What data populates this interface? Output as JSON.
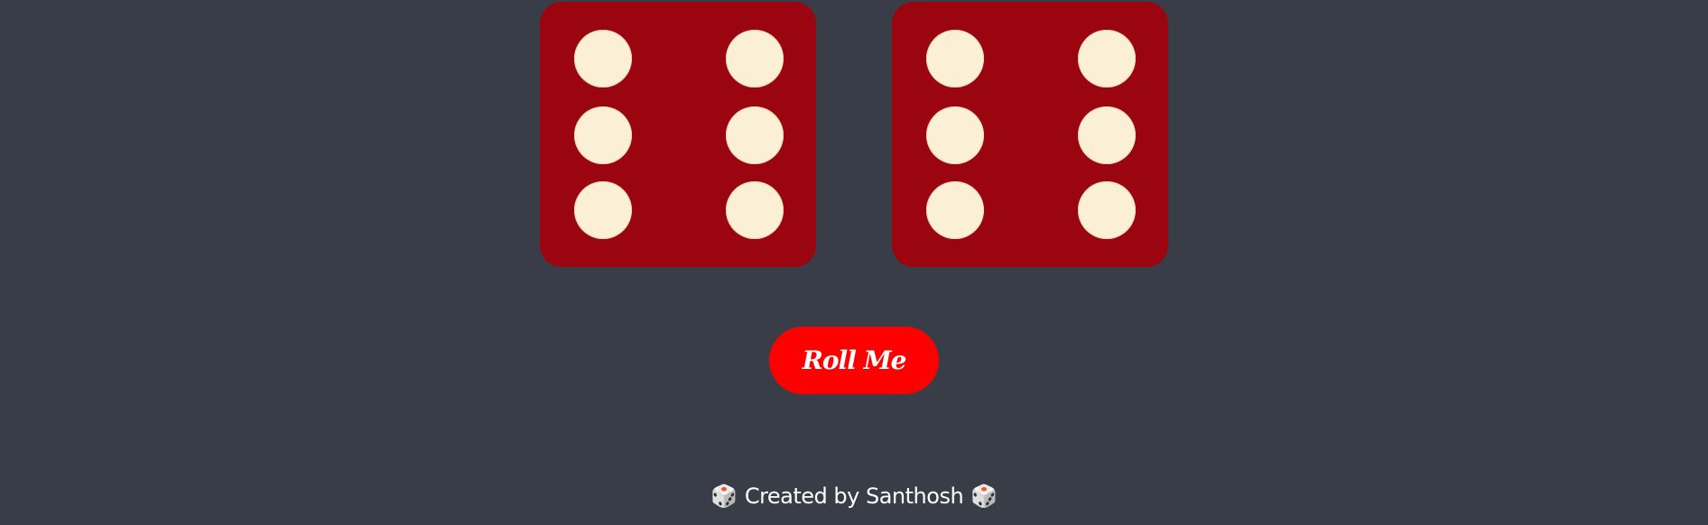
{
  "dice": [
    {
      "name": "left-die",
      "value": 6
    },
    {
      "name": "right-die",
      "value": 6
    }
  ],
  "button": {
    "label": "Roll Me"
  },
  "footer": {
    "text": "Created by Santhosh",
    "left_icon": "🎲",
    "right_icon": "🎲"
  },
  "colors": {
    "background": "#393d47",
    "die": "#9b0510",
    "pip": "#fbefd6",
    "button": "#ff0000",
    "text": "#ffffff"
  }
}
